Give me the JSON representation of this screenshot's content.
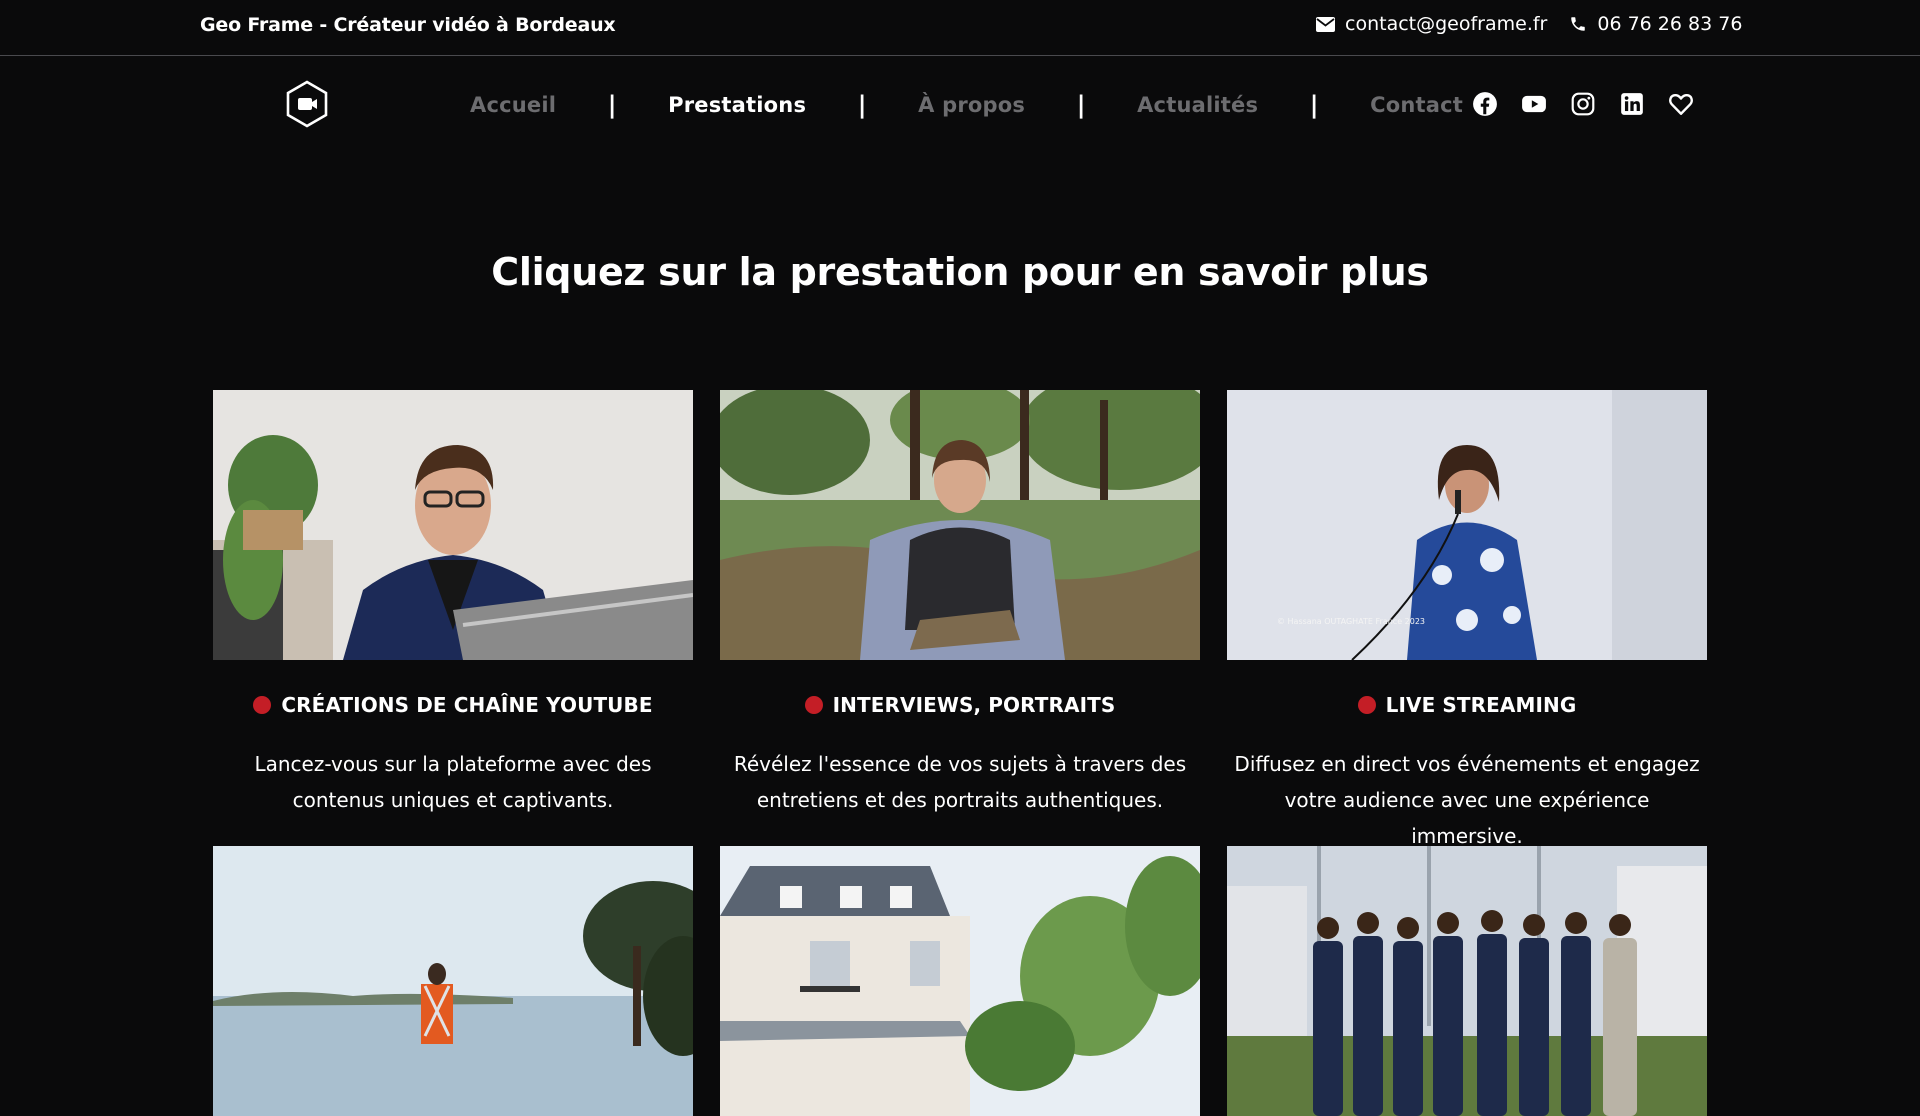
{
  "topbar": {
    "site_title": "Geo Frame - Créateur vidéo à Bordeaux",
    "email": "contact@geoframe.fr",
    "phone": "06 76 26 83 76",
    "email_icon": "envelope-icon",
    "phone_icon": "phone-icon"
  },
  "logo": {
    "icon": "video-camera-hexagon-logo"
  },
  "nav": {
    "items": [
      {
        "label": "Accueil",
        "active": false
      },
      {
        "label": "Prestations",
        "active": true
      },
      {
        "label": "À propos",
        "active": false
      },
      {
        "label": "Actualités",
        "active": false
      },
      {
        "label": "Contact",
        "active": false
      }
    ],
    "separator": "|"
  },
  "social": [
    "facebook-icon",
    "youtube-icon",
    "instagram-icon",
    "linkedin-icon",
    "vimeo-heart-icon"
  ],
  "heading": "Cliquez sur la prestation pour en savoir plus",
  "services": [
    {
      "title": "CRÉATIONS DE CHAÎNE YOUTUBE",
      "description_line1": "Lancez-vous sur la plateforme avec des",
      "description_line2": "contenus uniques et captivants."
    },
    {
      "title": "INTERVIEWS, PORTRAITS",
      "description_line1": "Révélez l'essence de vos sujets à travers des",
      "description_line2": "entretiens et des portraits authentiques."
    },
    {
      "title": "LIVE STREAMING",
      "description_line1": "Diffusez en direct vos événements et engagez",
      "description_line2": "votre audience avec une expérience immersive."
    }
  ],
  "photo_watermark": "© Hassana OUTAGHATE France 2023",
  "colors": {
    "background": "#0a0a0b",
    "accent_dot": "#c41e26",
    "nav_inactive": "#6d6d70"
  }
}
